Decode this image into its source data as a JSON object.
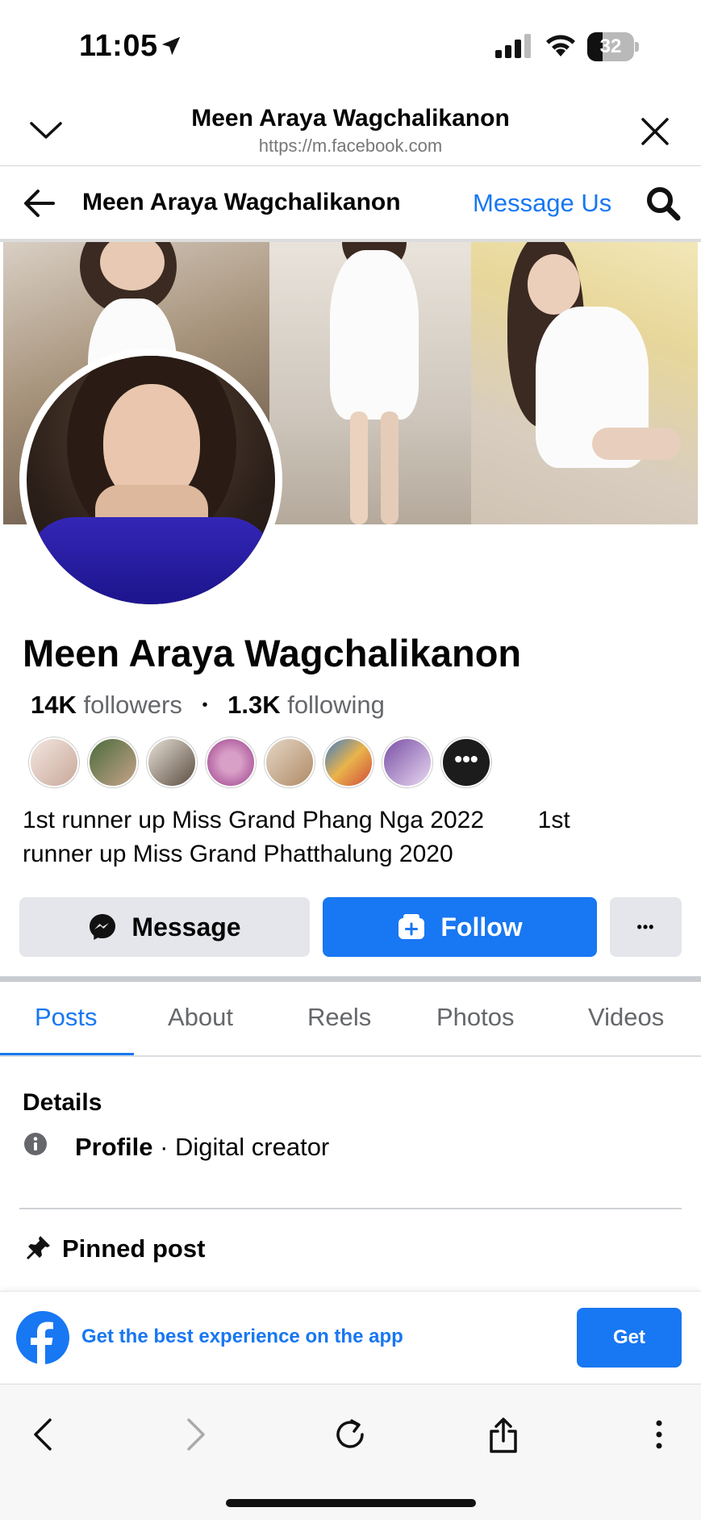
{
  "status_bar": {
    "time": "11:05",
    "battery": 32,
    "battery_label": "32"
  },
  "browser": {
    "title": "Meen Araya Wagchalikanon",
    "url": "https://m.facebook.com"
  },
  "fb_nav": {
    "title": "Meen Araya Wagchalikanon",
    "message_us": "Message Us"
  },
  "profile": {
    "name": "Meen Araya Wagchalikanon",
    "followers_count": "14K",
    "followers_label": "followers",
    "following_count": "1.3K",
    "following_label": "following",
    "more_friends_label": "•••",
    "bio_line1": "1st runner up Miss Grand Phang Nga 2022        1st",
    "bio_line2": "runner up Miss Grand Phatthalung 2020"
  },
  "actions": {
    "message": "Message",
    "follow": "Follow",
    "more": "•••"
  },
  "tabs": [
    {
      "label": "Posts"
    },
    {
      "label": "About"
    },
    {
      "label": "Reels"
    },
    {
      "label": "Photos"
    },
    {
      "label": "Videos"
    }
  ],
  "details": {
    "heading": "Details",
    "profile_label": "Profile",
    "profile_value": " · Digital creator"
  },
  "pinned": {
    "heading": "Pinned post"
  },
  "app_banner": {
    "text": "Get the best experience on the app",
    "button": "Get"
  },
  "colors": {
    "brand": "#1877f2",
    "secondary_button": "#e4e6eb"
  }
}
